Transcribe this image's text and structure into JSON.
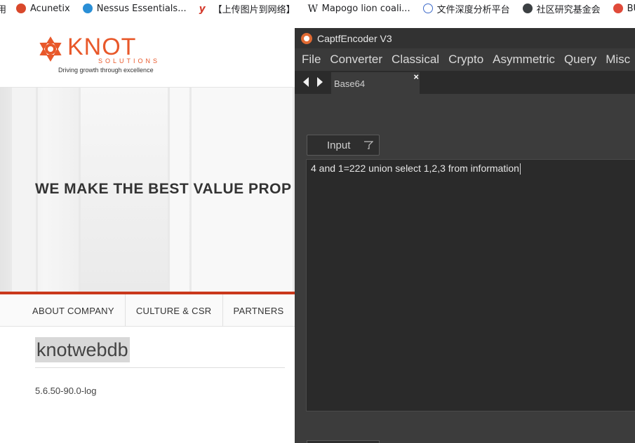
{
  "bookmarks": {
    "items": [
      {
        "label": "用",
        "icon": "cut-off-icon"
      },
      {
        "label": "Acunetix",
        "icon": "acunetix-icon"
      },
      {
        "label": "Nessus Essentials...",
        "icon": "nessus-icon"
      },
      {
        "label": "【上传图片到网络】",
        "icon": "y-logo-icon"
      },
      {
        "label": "Mapogo lion coali...",
        "icon": "wikipedia-icon"
      },
      {
        "label": "文件深度分析平台",
        "icon": "cloud-icon"
      },
      {
        "label": "社区研究基金会",
        "icon": "globe-icon"
      },
      {
        "label": "BU",
        "icon": "flag-icon"
      }
    ]
  },
  "site": {
    "logo": {
      "name": "KNOT",
      "sub": "SOLUTIONS",
      "tagline": "Driving growth through excellence"
    },
    "hero_title": "WE MAKE THE BEST VALUE PROP",
    "nav": [
      "ABOUT COMPANY",
      "CULTURE & CSR",
      "PARTNERS"
    ],
    "db_name": "knotwebdb",
    "db_version": "5.6.50-90.0-log"
  },
  "app": {
    "title": "CaptfEncoder V3",
    "menu": [
      "File",
      "Converter",
      "Classical",
      "Crypto",
      "Asymmetric",
      "Query",
      "Misc"
    ],
    "tab_label": "Base64",
    "tab_close": "×",
    "input_label": "Input",
    "input_text": "4 and 1=222 union select 1,2,3 from information"
  },
  "colors": {
    "brand_orange": "#e8582a",
    "hero_rule": "#c9381b",
    "app_bg": "#3c3c3c"
  }
}
